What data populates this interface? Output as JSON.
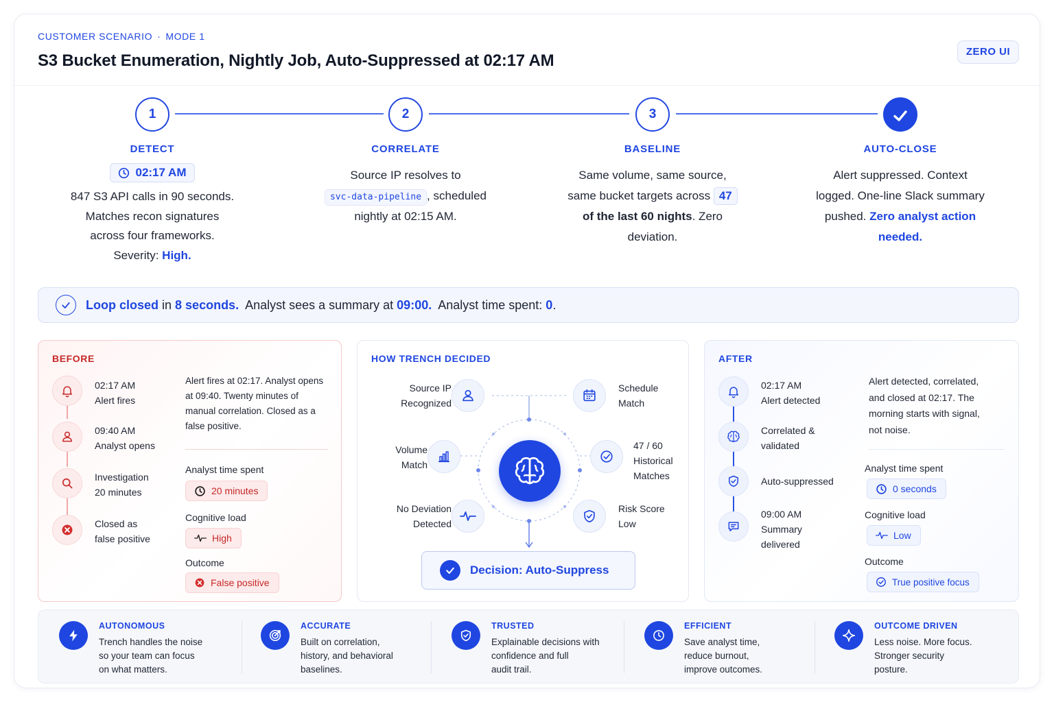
{
  "header": {
    "eyebrow_left": "CUSTOMER SCENARIO",
    "eyebrow_dot": "·",
    "eyebrow_right": "MODE 1",
    "title": "S3 Bucket Enumeration, Nightly Job, Auto-Suppressed at 02:17 AM",
    "badge": "ZERO UI"
  },
  "steps": [
    {
      "number": "1",
      "label": "DETECT",
      "time": "02:17 AM",
      "lines": [
        "847 S3 API calls in 90 seconds.",
        "Matches recon signatures",
        "across four frameworks."
      ],
      "severity_prefix": "Severity: ",
      "severity_value": "High."
    },
    {
      "number": "2",
      "label": "CORRELATE",
      "line1": "Source IP resolves to",
      "code": "svc-data-pipeline",
      "line2_suffix": ", scheduled",
      "line3": "nightly at 02:15 AM."
    },
    {
      "number": "3",
      "label": "BASELINE",
      "line1": "Same volume, same source,",
      "line2": "same bucket targets across",
      "count": "47",
      "bold": "of the last 60 nights",
      "line3_suffix": ". Zero",
      "line4": "deviation."
    },
    {
      "number": "",
      "label": "AUTO-CLOSE",
      "line1": "Alert suppressed. Context",
      "line2": "logged. One-line Slack summary",
      "line3_prefix": "pushed. ",
      "highlight_a": "Zero analyst action",
      "highlight_b": "needed."
    }
  ],
  "banner": {
    "loop": "Loop closed",
    "in": " in ",
    "duration": "8 seconds.",
    "mid": "  Analyst sees a summary at ",
    "time": "09:00.",
    "spent": "  Analyst time spent: ",
    "value": "0",
    "period": "."
  },
  "before": {
    "title": "BEFORE",
    "timeline": [
      {
        "icon": "bell-icon",
        "time": "02:17 AM",
        "text": "Alert fires"
      },
      {
        "icon": "user-icon",
        "time": "09:40 AM",
        "text": "Analyst opens"
      },
      {
        "icon": "search-icon",
        "time": "Investigation",
        "text": "20 minutes"
      },
      {
        "icon": "x-circle-icon",
        "time": "Closed as",
        "text": "false positive"
      }
    ],
    "description": [
      "Alert fires at 02:17. Analyst opens",
      "at 09:40. Twenty minutes of",
      "manual correlation. Closed as a",
      "false positive."
    ],
    "time_spent_label": "Analyst time spent",
    "time_spent": "20 minutes",
    "cognitive_label": "Cognitive load",
    "cognitive": "High",
    "outcome_label": "Outcome",
    "outcome": "False positive"
  },
  "how": {
    "title": "HOW TRENCH DECIDED",
    "nodes": {
      "source_ip": [
        "Source IP",
        "Recognized"
      ],
      "schedule": [
        "Schedule",
        "Match"
      ],
      "volume": [
        "Volume",
        "Match"
      ],
      "historical": [
        "47 / 60",
        "Historical",
        "Matches"
      ],
      "no_deviation": [
        "No Deviation",
        "Detected"
      ],
      "risk": [
        "Risk Score",
        "Low"
      ]
    },
    "decision": "Decision: Auto-Suppress"
  },
  "after": {
    "title": "AFTER",
    "timeline": [
      {
        "icon": "bell-icon",
        "l1": "02:17 AM",
        "l2": "Alert detected",
        "l3": ""
      },
      {
        "icon": "brain-icon",
        "l1": "Correlated &",
        "l2": "validated",
        "l3": ""
      },
      {
        "icon": "shield-check-icon",
        "l1": "Auto-suppressed",
        "l2": "",
        "l3": ""
      },
      {
        "icon": "message-icon",
        "l1": "09:00 AM",
        "l2": "Summary",
        "l3": "delivered"
      }
    ],
    "description": [
      "Alert detected, correlated,",
      "and closed at 02:17. The",
      "morning starts with signal,",
      "not noise."
    ],
    "time_spent_label": "Analyst time spent",
    "time_spent": "0 seconds",
    "cognitive_label": "Cognitive load",
    "cognitive": "Low",
    "outcome_label": "Outcome",
    "outcome": "True positive focus"
  },
  "pillars": [
    {
      "icon": "lightning-icon",
      "title": "AUTONOMOUS",
      "lines": [
        "Trench handles the noise",
        "so your team can focus",
        "on what matters."
      ]
    },
    {
      "icon": "target-icon",
      "title": "ACCURATE",
      "lines": [
        "Built on correlation,",
        "history, and behavioral",
        "baselines."
      ]
    },
    {
      "icon": "shield-icon",
      "title": "TRUSTED",
      "lines": [
        "Explainable decisions with",
        "confidence and full",
        "audit trail."
      ]
    },
    {
      "icon": "clock-icon",
      "title": "EFFICIENT",
      "lines": [
        "Save analyst time,",
        "reduce burnout,",
        "improve outcomes."
      ]
    },
    {
      "icon": "sparkle-icon",
      "title": "OUTCOME DRIVEN",
      "lines": [
        "Less noise. More focus.",
        "Stronger security",
        "posture."
      ]
    }
  ],
  "colors": {
    "accent": "#1f46e0",
    "danger": "#c62828",
    "danger_bg": "#fdeaea",
    "accent_bg": "#f0f4ff"
  }
}
